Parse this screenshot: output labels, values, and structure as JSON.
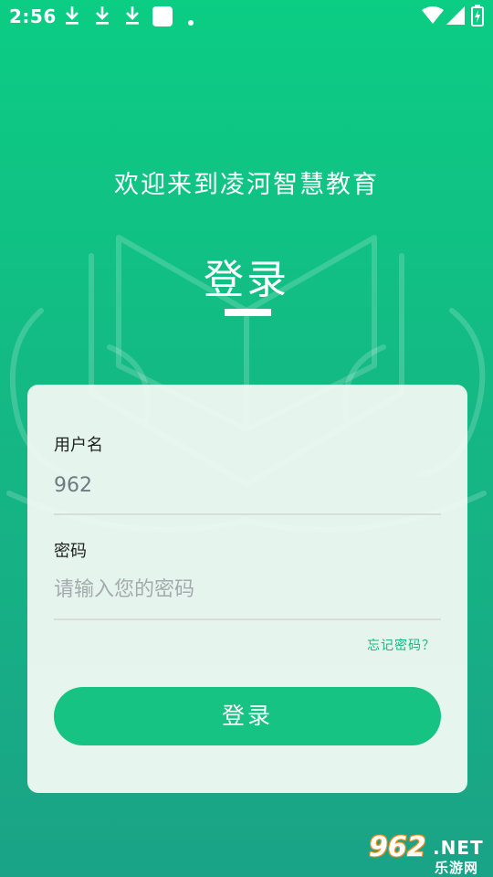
{
  "status_bar": {
    "time": "2:56",
    "icons": [
      "download-icon",
      "download-icon",
      "download-icon",
      "app-square-icon",
      "notification-dot-icon",
      "wifi-icon",
      "signal-icon",
      "battery-charging-icon"
    ]
  },
  "header": {
    "welcome": "欢迎来到凌河智慧教育",
    "title": "登录"
  },
  "form": {
    "username_label": "用户名",
    "username_value": "962",
    "password_label": "密码",
    "password_placeholder": "请输入您的密码",
    "forgot_label": "忘记密码？",
    "submit_label": "登录"
  },
  "watermark": {
    "number": "962",
    "domain": ".NET",
    "site_name": "乐游网"
  },
  "colors": {
    "accent": "#16c382",
    "background_top": "#0bcd84",
    "background_bottom": "#1aa387",
    "link": "#15b980"
  }
}
